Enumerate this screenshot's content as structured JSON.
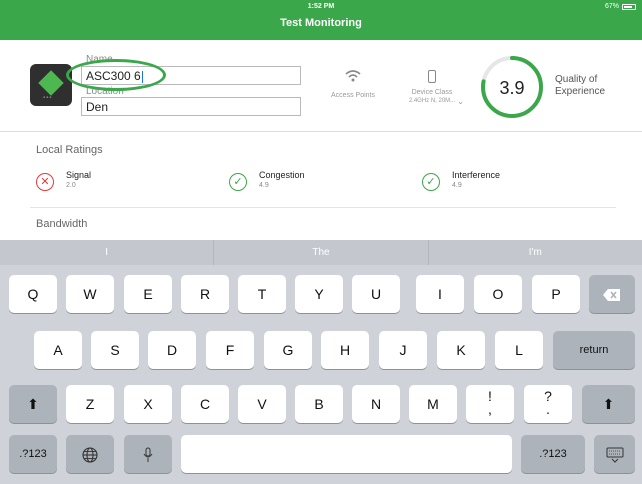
{
  "status": {
    "time": "1:52 PM",
    "title": "Test Monitoring",
    "battery": "67%"
  },
  "device": {
    "name_label": "Name",
    "name_value": "ASC300 6",
    "location_label": "Location",
    "location_value": "Den",
    "access_points_label": "Access Points",
    "device_class_label": "Device Class",
    "device_class_value": "2.4GHz N, 20M...",
    "qoe_score": "3.9",
    "qoe_fraction": 0.78,
    "qoe_label_line1": "Quality of",
    "qoe_label_line2": "Experience"
  },
  "local_ratings": {
    "title": "Local Ratings",
    "items": [
      {
        "name": "Signal",
        "value": "2.0",
        "status": "bad"
      },
      {
        "name": "Congestion",
        "value": "4.9",
        "status": "good"
      },
      {
        "name": "Interference",
        "value": "4.9",
        "status": "good"
      }
    ]
  },
  "bandwidth": {
    "title": "Bandwidth"
  },
  "keyboard": {
    "suggestions": [
      "I",
      "The",
      "I'm"
    ],
    "row1": [
      "Q",
      "W",
      "E",
      "R",
      "T",
      "Y",
      "U",
      "I",
      "O",
      "P"
    ],
    "row2": [
      "A",
      "S",
      "D",
      "F",
      "G",
      "H",
      "J",
      "K",
      "L"
    ],
    "return": "return",
    "row3": [
      "Z",
      "X",
      "C",
      "V",
      "B",
      "N",
      "M"
    ],
    "punct1": [
      "!",
      ","
    ],
    "punct2": [
      "?",
      "."
    ],
    "numbers_left": ".?123",
    "numbers_right": ".?123"
  },
  "colors": {
    "brand": "#3aa74a",
    "bad": "#e23a3a"
  }
}
